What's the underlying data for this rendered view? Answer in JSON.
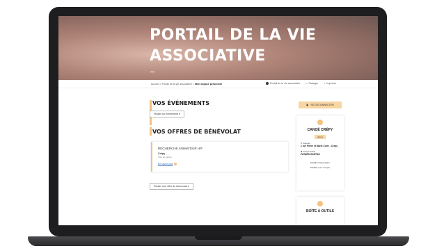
{
  "hero": {
    "title_line1": "PORTAIL DE LA VIE",
    "title_line2": "ASSOCIATIVE"
  },
  "breadcrumb": {
    "path": "Accueil > Portail de la vie associative > ",
    "current": "Mon espace personnel"
  },
  "actions": {
    "portal": "Portail de la vie associative",
    "share": "Partager",
    "print": "Imprimer"
  },
  "events": {
    "title": "VOS ÉVÉNEMENTS",
    "button": "Publier un événement"
  },
  "volunteering": {
    "title": "VOS OFFRES DE BÉNÉVOLAT",
    "offer": {
      "title": "RECHERCHE ANIMATEUR H/F",
      "city": "Crépy",
      "subtitle": "Pôle de Valbon",
      "link": "En savoir plus"
    },
    "button": "Publier une offre de bénévolat"
  },
  "sidebar": {
    "logout": "SE DÉCONNECTER",
    "assoc_name": "CANOË CRÉPY",
    "tag": "Sport",
    "address_label": "Adresse",
    "address": "1 rue Pierre et Marie Curie - Crépy",
    "manager_label": "Responsable",
    "manager": "PATARD GAETAN",
    "edit_assoc": "Modifier l'association",
    "edit_account": "Modifier mon compte",
    "toolbox": "BOÎTE À OUTILS"
  },
  "colors": {
    "accent": "#f3c27c",
    "accent_light": "#f8d6a3",
    "bezel": "#1e1e20"
  },
  "icons": [
    "user-icon",
    "share-icon",
    "print-icon",
    "logout-icon",
    "pin-icon",
    "person-icon"
  ]
}
